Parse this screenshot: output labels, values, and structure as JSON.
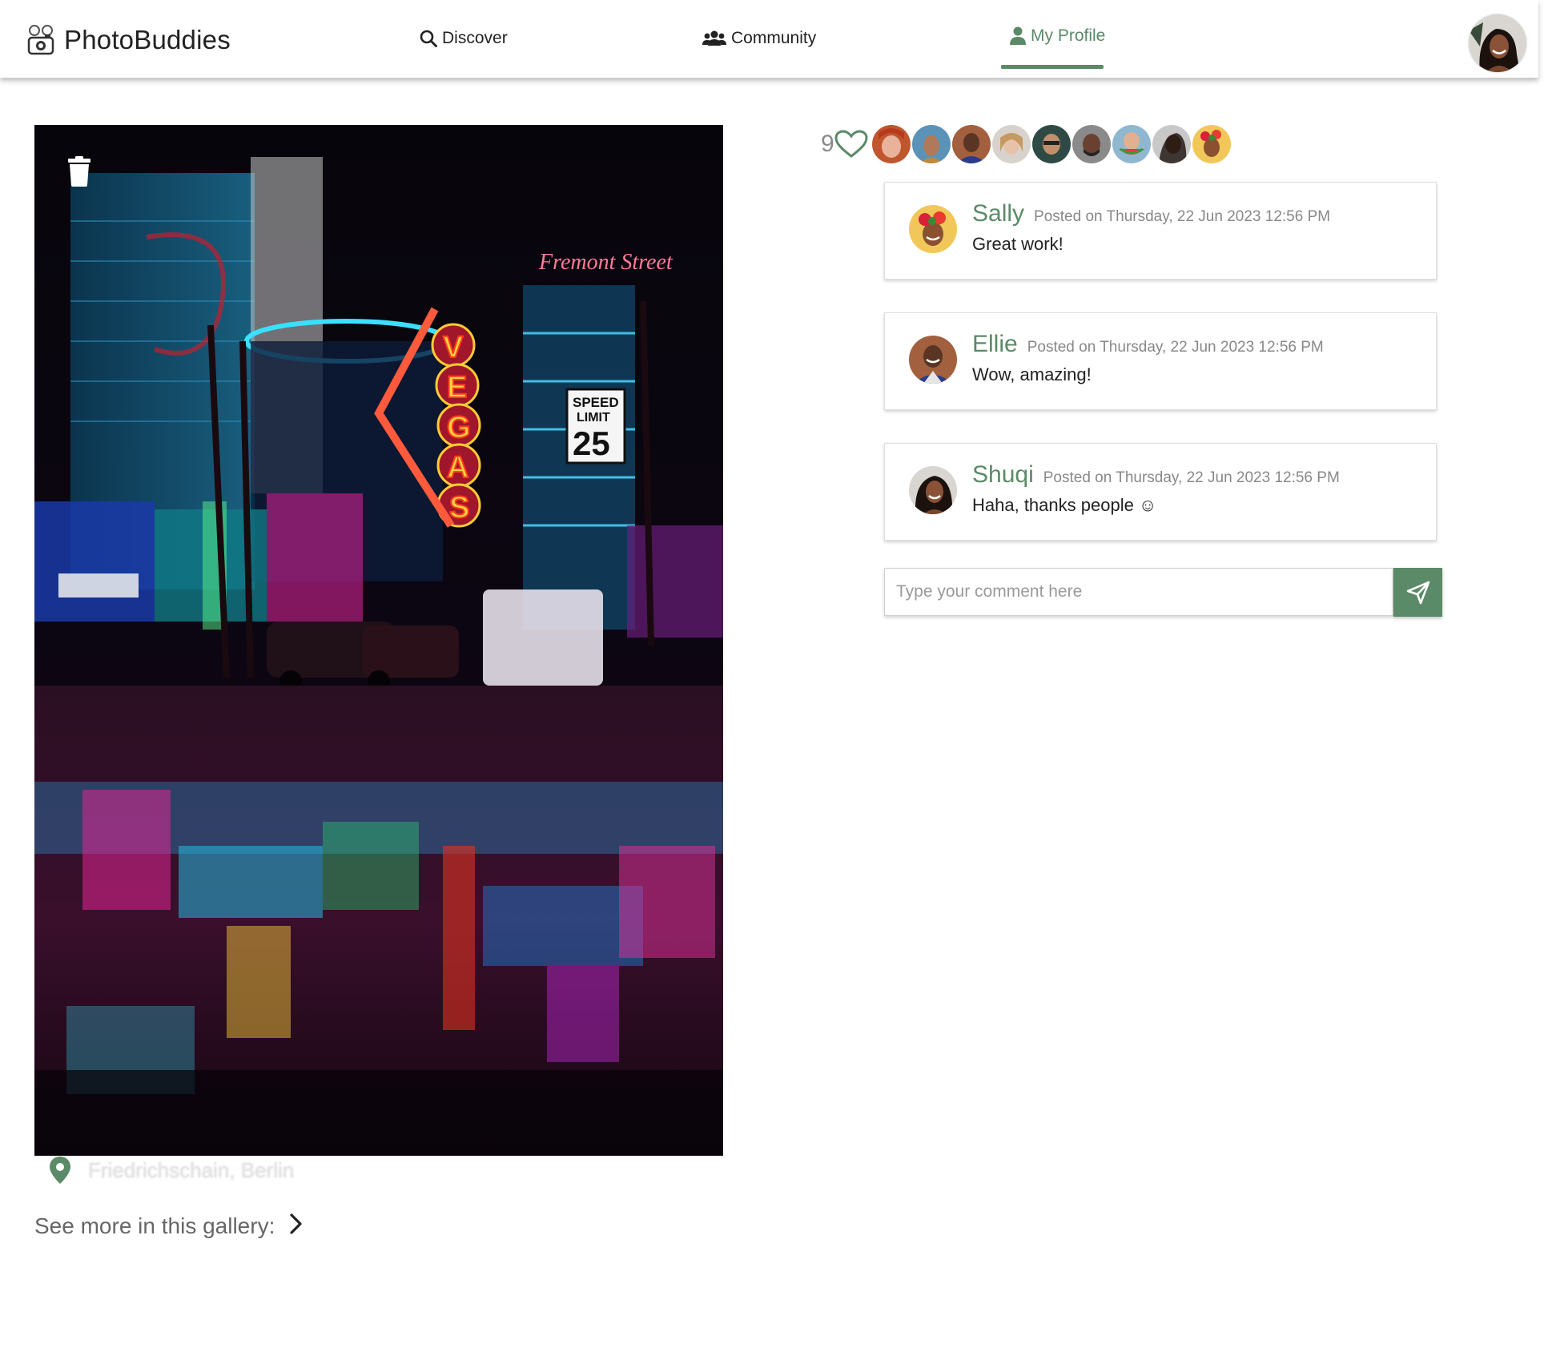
{
  "app": {
    "brand": "PhotoBuddies",
    "accent_color": "#5a8a67"
  },
  "nav": {
    "discover": "Discover",
    "community": "Community",
    "my_profile": "My Profile",
    "active_tab": "my_profile"
  },
  "photo": {
    "location": "Friedrichschain, Berlin",
    "see_more": "See more in this gallery:"
  },
  "likes": {
    "count": "9",
    "likers": [
      "liker-1",
      "liker-2",
      "liker-3",
      "liker-4",
      "liker-5",
      "liker-6",
      "liker-7",
      "liker-8",
      "liker-9"
    ]
  },
  "comments": [
    {
      "name": "Sally",
      "date": "Posted on Thursday, 22 Jun 2023 12:56 PM",
      "text": "Great work!"
    },
    {
      "name": "Ellie",
      "date": "Posted on Thursday, 22 Jun 2023 12:56 PM",
      "text": "Wow, amazing!"
    },
    {
      "name": "Shuqi",
      "date": "Posted on Thursday, 22 Jun 2023 12:56 PM",
      "text": "Haha, thanks people ☺"
    }
  ],
  "comment_input": {
    "placeholder": "Type your comment here",
    "value": ""
  },
  "icons": {
    "discover": "search-icon",
    "community": "users-icon",
    "profile": "user-icon",
    "delete": "trash-icon",
    "location": "map-pin-icon",
    "next": "chevron-right-icon",
    "like": "heart-icon",
    "send": "paper-plane-icon"
  }
}
